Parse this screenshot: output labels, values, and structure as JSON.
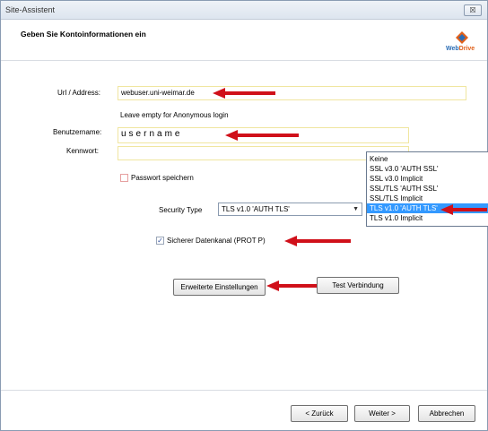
{
  "window": {
    "title": "Site-Assistent",
    "close_label": "☒"
  },
  "header": {
    "title": "Geben Sie Kontoinformationen ein",
    "logo_text_a": "Web",
    "logo_text_b": "Drive"
  },
  "form": {
    "url_label": "Url / Address:",
    "url_value": "webuser.uni-weimar.de",
    "anon_hint": "Leave empty for Anonymous login",
    "user_label": "Benutzername:",
    "user_value": "username",
    "pw_label": "Kennwort:",
    "pw_value": "",
    "save_pw_label": "Passwort speichern",
    "save_pw_checked": false,
    "security_label": "Security Type",
    "security_value": "TLS v1.0 'AUTH TLS'",
    "secure_channel_label": "Sicherer Datenkanal (PROT P)",
    "secure_channel_checked": true
  },
  "dropdown": {
    "options": [
      "Keine",
      "SSL v3.0 'AUTH SSL'",
      "SSL v3.0 Implicit",
      "SSL/TLS 'AUTH SSL'",
      "SSL/TLS Implicit",
      "TLS v1.0 'AUTH TLS'",
      "TLS v1.0 Implicit"
    ],
    "selected_index": 5
  },
  "buttons": {
    "advanced": "Erweiterte Einstellungen",
    "test": "Test Verbindung",
    "back": "< Zurück",
    "next": "Weiter >",
    "cancel": "Abbrechen"
  },
  "colors": {
    "annotation_arrow": "#d0101a",
    "selection": "#3399ff",
    "logo_blue": "#2b6db5",
    "logo_orange": "#e0601a"
  }
}
